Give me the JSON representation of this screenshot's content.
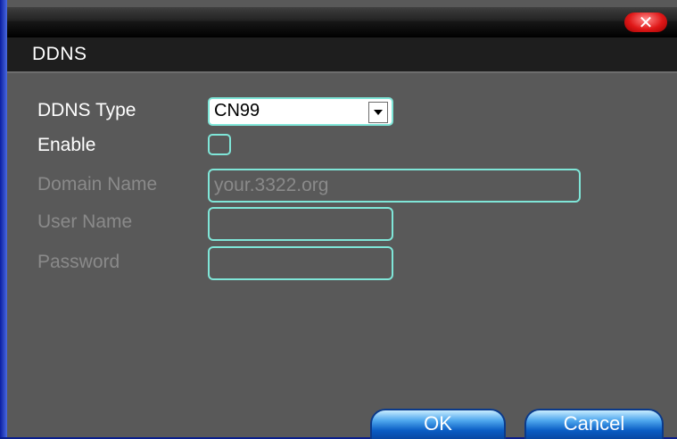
{
  "window": {
    "title": "DDNS",
    "close_icon": "close-x-icon"
  },
  "form": {
    "ddns_type": {
      "label": "DDNS Type",
      "value": "CN99"
    },
    "enable": {
      "label": "Enable",
      "checked": false
    },
    "domain_name": {
      "label": "Domain Name",
      "value": "your.3322.org"
    },
    "user_name": {
      "label": "User Name",
      "value": ""
    },
    "password": {
      "label": "Password",
      "value": ""
    }
  },
  "buttons": {
    "ok": "OK",
    "cancel": "Cancel"
  },
  "colors": {
    "field_border": "#7fe6d8",
    "panel_bg": "#595959",
    "header_bg": "#1e1e1e",
    "close_red": "#e01818",
    "button_blue": "#0a5dc4"
  }
}
